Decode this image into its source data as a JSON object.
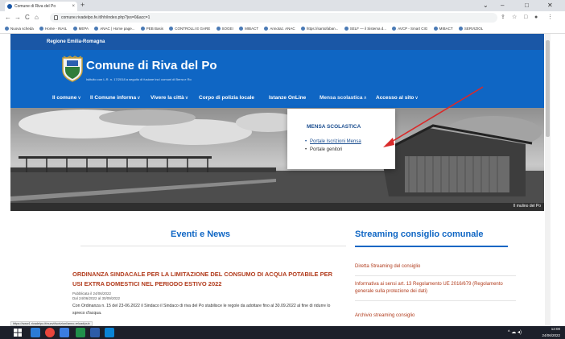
{
  "browser": {
    "tab_title": "Comune di Riva del Po",
    "tab_close": "×",
    "new_tab": "+",
    "window_controls": [
      "⌄",
      "–",
      "□",
      "✕"
    ],
    "nav_buttons": [
      "←",
      "→",
      "C",
      "⌂"
    ],
    "url": "comune.rivadelpo.fe.it/hh/index.php?jvs=0&acc=1",
    "toolbar_icons": [
      "⇪",
      "☆",
      "□",
      "●",
      "⋮"
    ],
    "bookmarks": [
      "Nuova scheda",
      "Home - INAIL",
      "MEPA",
      "ANAC | Home page...",
      "PEB Basis",
      "CONTROLLI E GARE",
      "SOGEI",
      "MIBACT",
      "Annotaz. ANAC",
      "https://santofaban...",
      "SELF — il Sistema d...",
      "AVCP - Smart CIG",
      "MIBACT",
      "SERVIZIOL"
    ],
    "status_url": "https://www1.rivadelpo.it/nuovi/iscrizioni/anno-reload/pub"
  },
  "page": {
    "region_name": "Regione Emilia-Romagna",
    "site_title": "Comune di Riva del Po",
    "site_subtitle": "Istituito con L.R. n. 17/2018 a seguito di fusione tra i comuni di Berra e Ro",
    "nav": [
      {
        "label": "Il comune",
        "chev": "∨"
      },
      {
        "label": "Il Comune informa",
        "chev": "∨"
      },
      {
        "label": "Vivere la città",
        "chev": "∨"
      },
      {
        "label": "Corpo di polizia locale",
        "chev": ""
      },
      {
        "label": "Istanze OnLine",
        "chev": ""
      },
      {
        "label": "Mensa scolastica",
        "chev": "∧"
      },
      {
        "label": "Accesso al sito",
        "chev": "∨"
      }
    ],
    "hero_caption": "Il mulino del Po",
    "dropdown": {
      "title": "MENSA SCOLASTICA",
      "items": [
        "Portale Iscrizioni Mensa",
        "Portale genitori"
      ]
    },
    "events": {
      "section_title": "Eventi e News",
      "headline": "ORDINANZA SINDACALE PER LA LIMITAZIONE DEL CONSUMO DI ACQUA POTABILE PER USI EXTRA DOMESTICI NEL PERIODO ESTIVO 2022",
      "published": "Pubblicata il 24/06/2022",
      "period": "Dal 24/06/2022 al 30/09/2022",
      "body": "Con Ordinanza n. 15 del 23-06.2022 il Sindaco il Sindaco di riva del Po stabilisce le regole da adottare fino al 30.09.2022 al fine di ridurre lo spreco d'acqua."
    },
    "streaming": {
      "section_title": "Streaming consiglio comunale",
      "items": [
        "Diretta Streaming del consiglio",
        "Informativa ai sensi art. 13 Regolamento UE 2016/679 (Regolamento generale sulla protezione dei dati)",
        "Archivio streaming consiglio"
      ]
    }
  },
  "taskbar": {
    "time": "12:00",
    "date": "24/06/2022",
    "tray_icons": "^ ☁ ◂)"
  },
  "colors": {
    "brand_blue": "#0f66c4",
    "region_blue": "#1a57a6",
    "headline_red": "#b13b1c",
    "annotation_arrow": "#d92a2a"
  }
}
